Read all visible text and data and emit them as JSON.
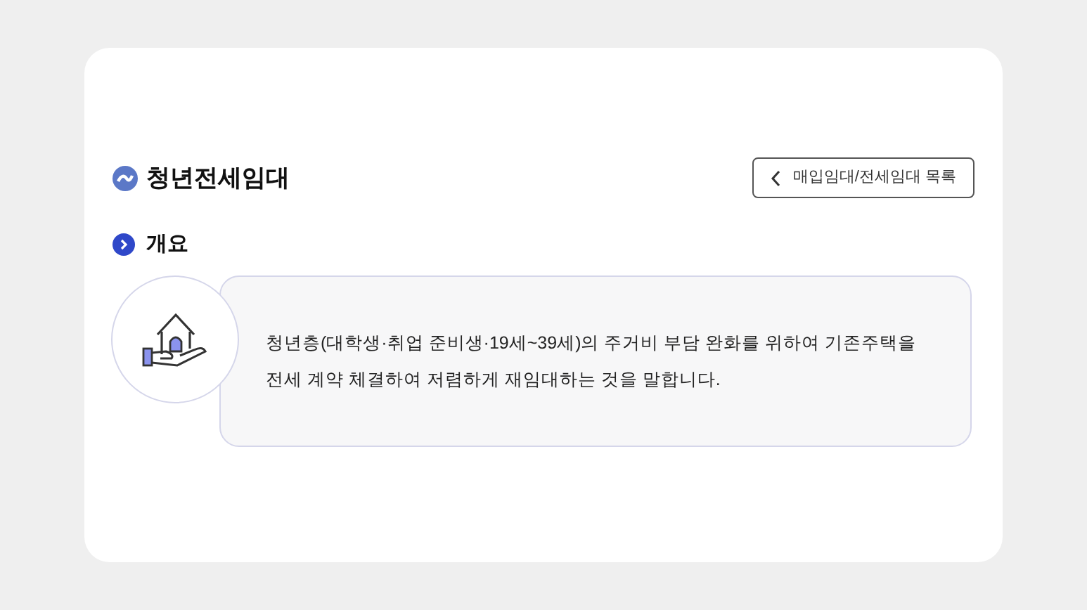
{
  "title": "청년전세임대",
  "back_button": {
    "label": "매입임대/전세임대 목록"
  },
  "section": {
    "heading": "개요",
    "description": "청년층(대학생·취업 준비생·19세~39세)의 주거비 부담 완화를 위하여 기존주택을 전세 계약 체결하여 저렴하게 재임대하는 것을 말합니다."
  }
}
